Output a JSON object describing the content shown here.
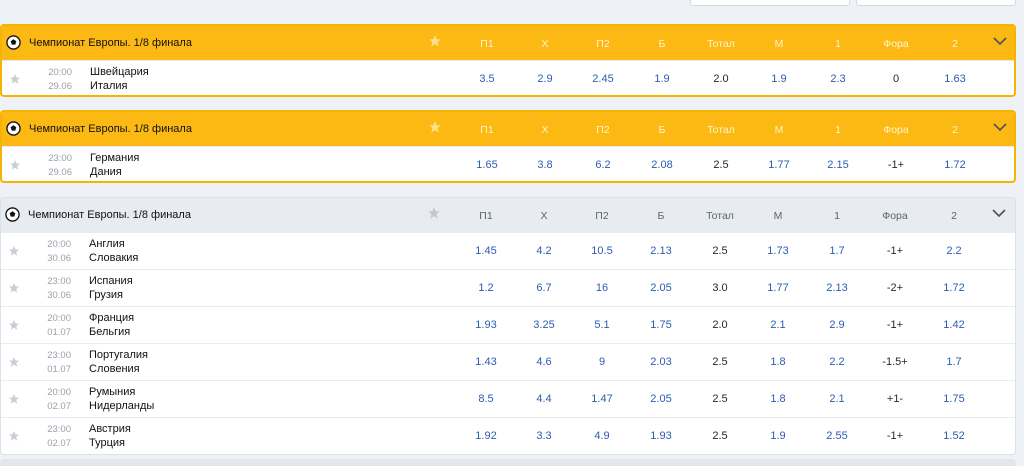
{
  "columns": [
    "П1",
    "Х",
    "П2",
    "Б",
    "Тотал",
    "М",
    "1",
    "Фора",
    "2"
  ],
  "sections": [
    {
      "title": "Чемпионат Европы. 1/8 финала",
      "matches": [
        {
          "time": "20:00",
          "date": "29.06",
          "home": "Швейцария",
          "away": "Италия",
          "odds": [
            "3.5",
            "2.9",
            "2.45",
            "1.9",
            "2.0",
            "1.9",
            "2.3",
            "0",
            "1.63"
          ]
        }
      ]
    },
    {
      "title": "Чемпионат Европы. 1/8 финала",
      "matches": [
        {
          "time": "23:00",
          "date": "29.06",
          "home": "Германия",
          "away": "Дания",
          "odds": [
            "1.65",
            "3.8",
            "6.2",
            "2.08",
            "2.5",
            "1.77",
            "2.15",
            "-1+",
            "1.72"
          ]
        }
      ]
    },
    {
      "title": "Чемпионат Европы. 1/8 финала",
      "matches": [
        {
          "time": "20:00",
          "date": "30.06",
          "home": "Англия",
          "away": "Словакия",
          "odds": [
            "1.45",
            "4.2",
            "10.5",
            "2.13",
            "2.5",
            "1.73",
            "1.7",
            "-1+",
            "2.2"
          ]
        },
        {
          "time": "23:00",
          "date": "30.06",
          "home": "Испания",
          "away": "Грузия",
          "odds": [
            "1.2",
            "6.7",
            "16",
            "2.05",
            "3.0",
            "1.77",
            "2.13",
            "-2+",
            "1.72"
          ]
        },
        {
          "time": "20:00",
          "date": "01.07",
          "home": "Франция",
          "away": "Бельгия",
          "odds": [
            "1.93",
            "3.25",
            "5.1",
            "1.75",
            "2.0",
            "2.1",
            "2.9",
            "-1+",
            "1.42"
          ]
        },
        {
          "time": "23:00",
          "date": "01.07",
          "home": "Португалия",
          "away": "Словения",
          "odds": [
            "1.43",
            "4.6",
            "9",
            "2.03",
            "2.5",
            "1.8",
            "2.2",
            "-1.5+",
            "1.7"
          ]
        },
        {
          "time": "20:00",
          "date": "02.07",
          "home": "Румыния",
          "away": "Нидерланды",
          "odds": [
            "8.5",
            "4.4",
            "1.47",
            "2.05",
            "2.5",
            "1.8",
            "2.1",
            "+1-",
            "1.75"
          ]
        },
        {
          "time": "23:00",
          "date": "02.07",
          "home": "Австрия",
          "away": "Турция",
          "odds": [
            "1.92",
            "3.3",
            "4.9",
            "1.93",
            "2.5",
            "1.9",
            "2.55",
            "-1+",
            "1.52"
          ]
        }
      ]
    }
  ],
  "colors": {
    "live_header": "#fdb913",
    "odds_blue": "#2b5db0"
  },
  "icons": {
    "league": "soccer-ball-icon",
    "favorite": "star-icon",
    "collapse": "chevron-down-icon"
  }
}
